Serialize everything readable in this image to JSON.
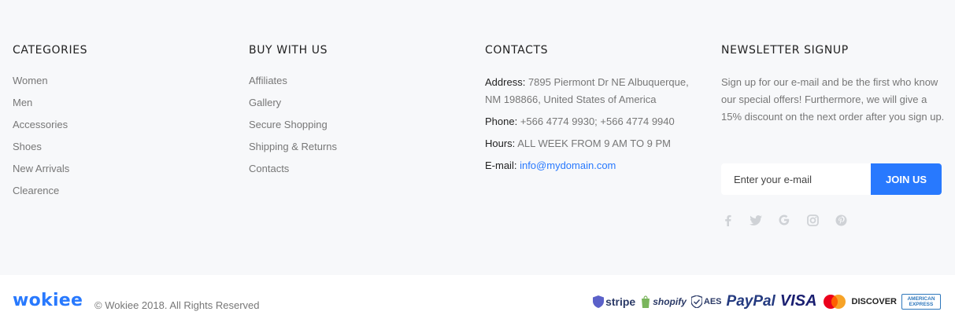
{
  "categories": {
    "heading": "CATEGORIES",
    "items": [
      "Women",
      "Men",
      "Accessories",
      "Shoes",
      "New Arrivals",
      "Clearence"
    ]
  },
  "buy_with_us": {
    "heading": "BUY WITH US",
    "items": [
      "Affiliates",
      "Gallery",
      "Secure Shopping",
      "Shipping & Returns",
      "Contacts"
    ]
  },
  "contacts": {
    "heading": "CONTACTS",
    "address_label": "Address:",
    "address_value": "7895 Piermont Dr NE Albuquerque, NM 198866, United States of America",
    "phone_label": "Phone:",
    "phone_value": "+566 4774 9930; +566 4774 9940",
    "hours_label": "Hours:",
    "hours_value": "ALL WEEK FROM 9 AM TO 9 PM",
    "email_label": "E-mail:",
    "email_value": "info@mydomain.com"
  },
  "newsletter": {
    "heading": "NEWSLETTER SIGNUP",
    "text": "Sign up for our e-mail and be the first who know our special offers! Furthermore, we will give a 15% discount on the next order after you sign up.",
    "input_placeholder": "Enter your e-mail",
    "button_label": "JOIN US",
    "social_icons": [
      "facebook-icon",
      "twitter-icon",
      "google-icon",
      "instagram-icon",
      "pinterest-icon"
    ]
  },
  "bottom": {
    "logo": "wokiee",
    "copyright": "© Wokiee 2018. All Rights Reserved",
    "payment_logos": [
      "stripe",
      "shopify",
      "AES",
      "PayPal",
      "VISA",
      "DISCOVER",
      "AMERICAN EXPRESS"
    ]
  },
  "colors": {
    "accent": "#2879fe",
    "footer_bg": "#f7f8fa",
    "heading": "#222222",
    "text": "#777777"
  }
}
